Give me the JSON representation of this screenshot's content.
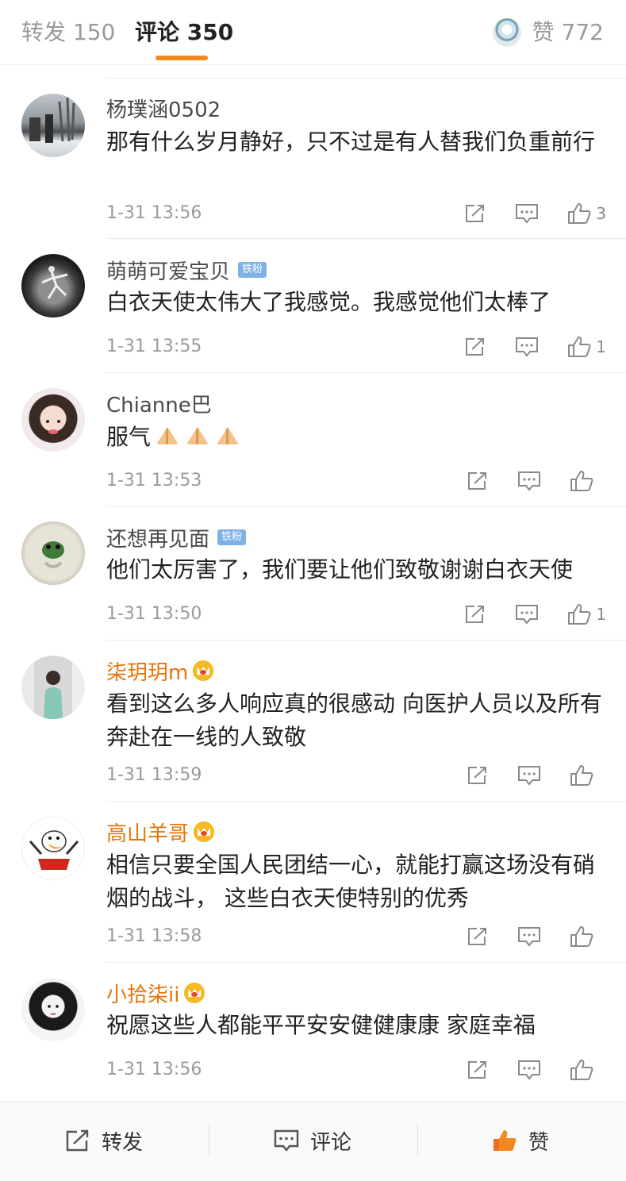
{
  "tabs": {
    "repost_label": "转发 150",
    "comments_label": "评论 350",
    "likes_label": "赞 772"
  },
  "comments": [
    {
      "username": "杨璞涵0502",
      "badge": "",
      "vip": false,
      "text": "那有什么岁月静好，只不过是有人替我们负重前行",
      "time": "1-31 13:56",
      "likes": "3",
      "avatar": "snowy-street-photo"
    },
    {
      "username": "萌萌可爱宝贝",
      "badge": "铁粉",
      "vip": false,
      "text": "白衣天使太伟大了我感觉。我感觉他们太棒了",
      "time": "1-31 13:55",
      "likes": "1",
      "avatar": "dancer-bw-photo"
    },
    {
      "username": "Chianne巴",
      "badge": "",
      "vip": false,
      "text": "服气",
      "emoji": [
        "pray-emoji",
        "pray-emoji",
        "pray-emoji"
      ],
      "time": "1-31 13:53",
      "likes": "",
      "avatar": "girl-selfie-photo"
    },
    {
      "username": "还想再见面",
      "badge": "铁粉",
      "vip": false,
      "text": "他们太厉害了，我们要让他们致敬谢谢白衣天使",
      "time": "1-31 13:50",
      "likes": "1",
      "avatar": "frog-toy-photo"
    },
    {
      "username": "柒玥玥m",
      "badge": "crown",
      "vip": true,
      "text": "看到这么多人响应真的很感动 向医护人员以及所有奔赴在一线的人致敬",
      "time": "1-31 13:59",
      "likes": "",
      "avatar": "woman-portrait-photo"
    },
    {
      "username": "高山羊哥",
      "badge": "crown",
      "vip": true,
      "text": "相信只要全国人民团结一心，就能打赢这场没有硝烟的战斗， 这些白衣天使特别的优秀",
      "time": "1-31 13:58",
      "likes": "",
      "avatar": "donald-duck-cartoon"
    },
    {
      "username": "小拾柒ii",
      "badge": "crown",
      "vip": true,
      "text": "祝愿这些人都能平平安安健健康康 家庭幸福",
      "time": "1-31 13:56",
      "likes": "",
      "avatar": "woman-bw-portrait"
    }
  ],
  "bottom": {
    "repost_label": "转发",
    "comment_label": "评论",
    "like_label": "赞"
  },
  "colors": {
    "accent": "#f5871f",
    "vip_name": "#e8750a",
    "fan_badge": "#7fb1e6",
    "muted": "#9a9a9a"
  }
}
